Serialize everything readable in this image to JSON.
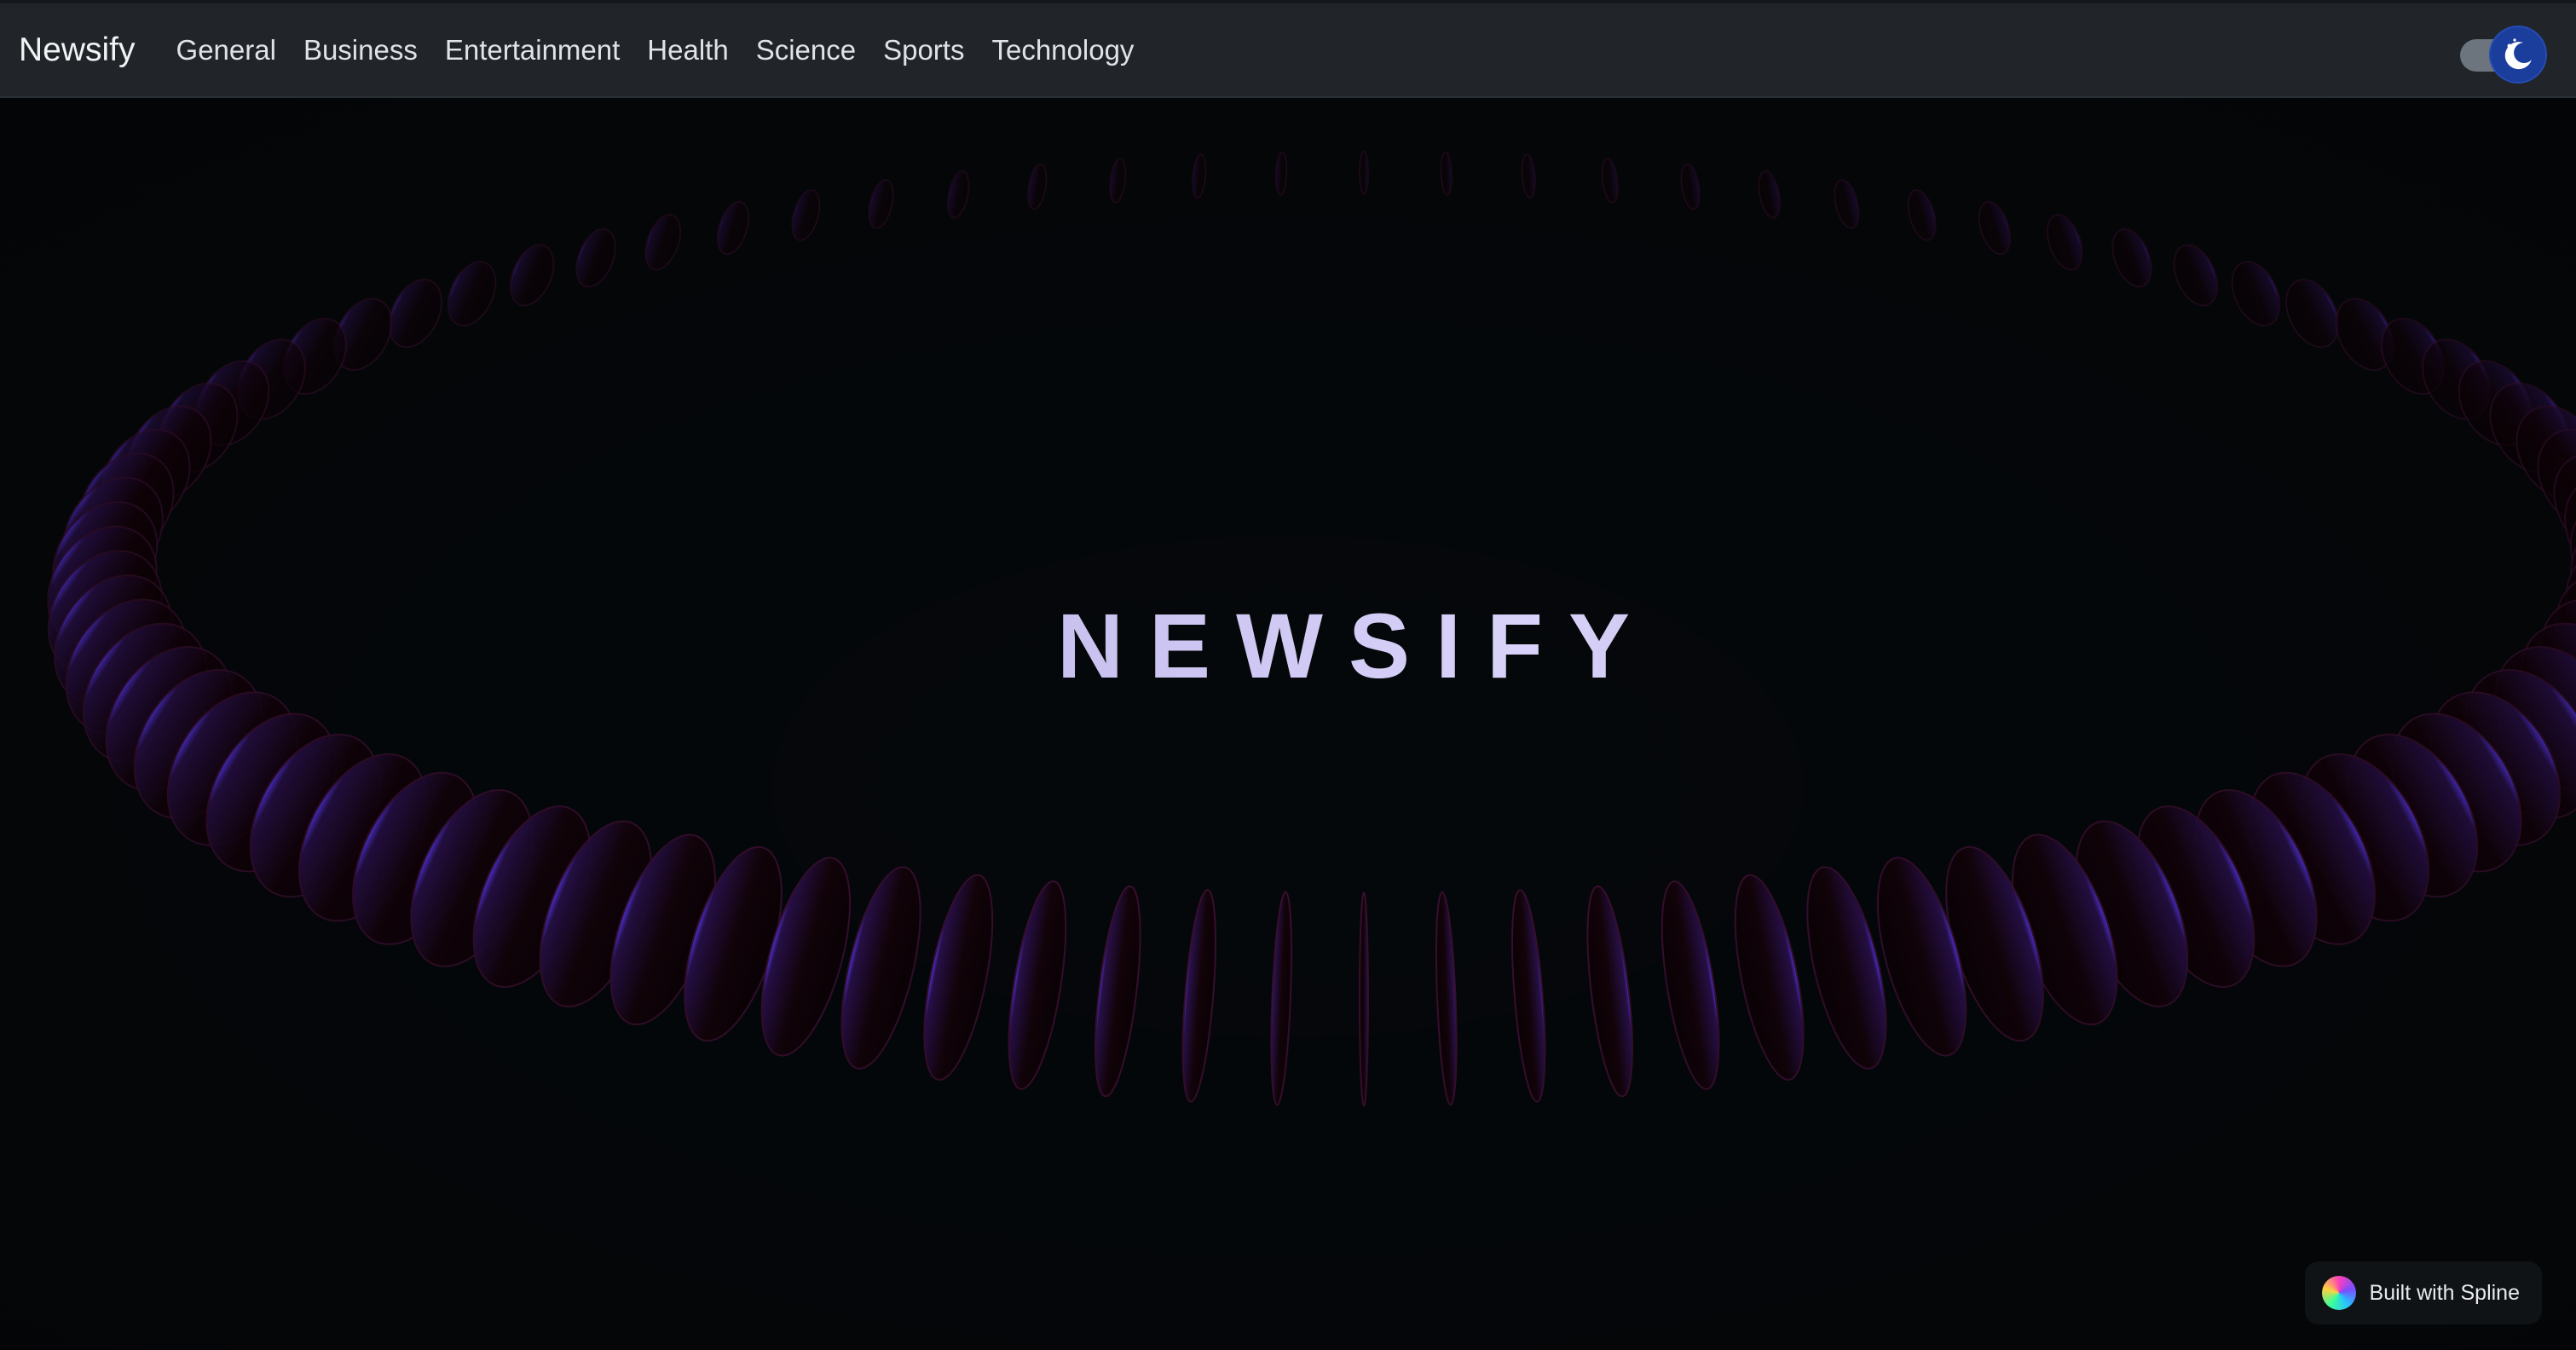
{
  "navbar": {
    "brand": "Newsify",
    "links": [
      "General",
      "Business",
      "Entertainment",
      "Health",
      "Science",
      "Sports",
      "Technology"
    ],
    "theme_toggle": {
      "state": "dark",
      "icon": "moon-icon"
    }
  },
  "hero": {
    "title": "NEWSIFY"
  },
  "badge": {
    "label": "Built with Spline",
    "icon": "spline-logo-icon"
  },
  "colors": {
    "navbar_bg": "#212529",
    "page_bg": "#05080b",
    "toggle_accent": "#1b3d9c",
    "ring_glow": "#4b2cff",
    "ring_body": "#2a0710"
  }
}
